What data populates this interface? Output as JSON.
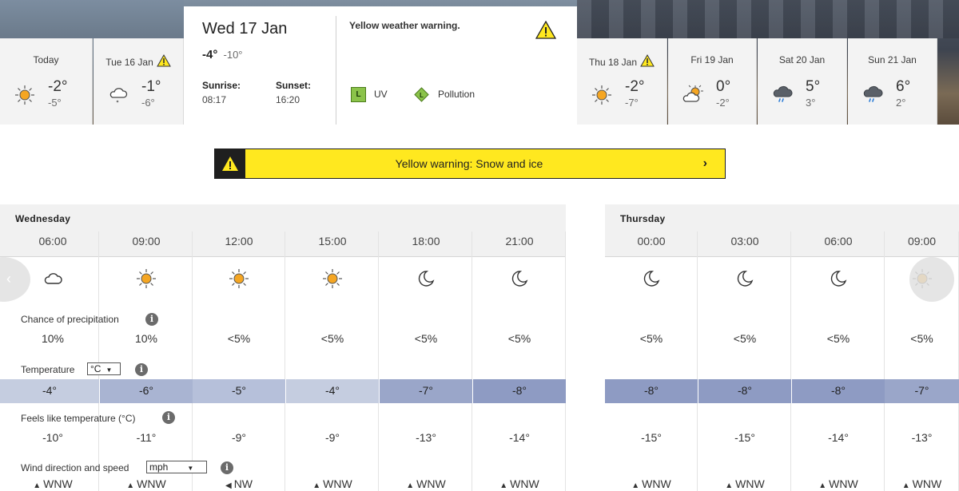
{
  "top": {
    "days": [
      {
        "label": "Today",
        "warn": false,
        "icon": "sun-icon",
        "hi": "-2°",
        "lo": "-5°"
      },
      {
        "label": "Tue 16 Jan",
        "warn": true,
        "icon": "cloud-snow-icon",
        "hi": "-1°",
        "lo": "-6°"
      },
      {
        "label": "Thu 18 Jan",
        "warn": true,
        "icon": "sun-icon",
        "hi": "-2°",
        "lo": "-7°"
      },
      {
        "label": "Fri 19 Jan",
        "warn": false,
        "icon": "sun-cloud-icon",
        "hi": "0°",
        "lo": "-2°"
      },
      {
        "label": "Sat 20 Jan",
        "warn": false,
        "icon": "rain-cloud-icon",
        "hi": "5°",
        "lo": "3°"
      },
      {
        "label": "Sun 21 Jan",
        "warn": false,
        "icon": "rain-cloud-icon",
        "hi": "6°",
        "lo": "2°"
      }
    ],
    "today": {
      "date": "Wed 17 Jan",
      "hi": "-4°",
      "lo": "-10°",
      "sunrise_label": "Sunrise:",
      "sunrise": "08:17",
      "sunset_label": "Sunset:",
      "sunset": "16:20",
      "warning_text": "Yellow weather warning.",
      "uv_badge": "L",
      "uv_label": "UV",
      "pollution_badge": "L",
      "pollution_label": "Pollution"
    }
  },
  "banner": {
    "text": "Yellow warning: Snow and ice",
    "chevron": "›"
  },
  "forecast": {
    "day1": "Wednesday",
    "day2": "Thursday",
    "precip_label": "Chance of precipitation",
    "temp_label": "Temperature",
    "temp_unit": "°C",
    "feels_label": "Feels like temperature (°C)",
    "wind_label": "Wind direction and speed",
    "wind_unit": "mph",
    "info_glyph": "i",
    "columns": [
      {
        "time": "06:00",
        "icon": "cloud-icon",
        "precip": "10%",
        "temp": "-4°",
        "feels": "-10°",
        "wind": "WNW",
        "wind_arrow": "▲",
        "band": "#c5cde0"
      },
      {
        "time": "09:00",
        "icon": "sun-icon",
        "precip": "10%",
        "temp": "-6°",
        "feels": "-11°",
        "wind": "WNW",
        "wind_arrow": "▲",
        "band": "#a9b4d2"
      },
      {
        "time": "12:00",
        "icon": "sun-icon",
        "precip": "<5%",
        "temp": "-5°",
        "feels": "-9°",
        "wind": "NW",
        "wind_arrow": "◀",
        "band": "#b6c0da"
      },
      {
        "time": "15:00",
        "icon": "sun-icon",
        "precip": "<5%",
        "temp": "-4°",
        "feels": "-9°",
        "wind": "WNW",
        "wind_arrow": "▲",
        "band": "#c5cde0"
      },
      {
        "time": "18:00",
        "icon": "moon-icon",
        "precip": "<5%",
        "temp": "-7°",
        "feels": "-13°",
        "wind": "WNW",
        "wind_arrow": "▲",
        "band": "#9aa6c9"
      },
      {
        "time": "21:00",
        "icon": "moon-icon",
        "precip": "<5%",
        "temp": "-8°",
        "feels": "-14°",
        "wind": "WNW",
        "wind_arrow": "▲",
        "band": "#8e9bc3"
      },
      {
        "time": "00:00",
        "icon": "moon-icon",
        "precip": "<5%",
        "temp": "-8°",
        "feels": "-15°",
        "wind": "WNW",
        "wind_arrow": "▲",
        "band": "#8e9bc3"
      },
      {
        "time": "03:00",
        "icon": "moon-icon",
        "precip": "<5%",
        "temp": "-8°",
        "feels": "-15°",
        "wind": "WNW",
        "wind_arrow": "▲",
        "band": "#8e9bc3"
      },
      {
        "time": "06:00",
        "icon": "moon-icon",
        "precip": "<5%",
        "temp": "-8°",
        "feels": "-14°",
        "wind": "WNW",
        "wind_arrow": "▲",
        "band": "#8e9bc3"
      },
      {
        "time": "09:00",
        "icon": "sun-icon",
        "precip": "<5%",
        "temp": "-7°",
        "feels": "-13°",
        "wind": "WNW",
        "wind_arrow": "▲",
        "band": "#9aa6c9"
      }
    ]
  },
  "colors": {
    "warning_yellow": "#ffe81f",
    "sun_orange": "#f5a623",
    "uv_green": "#8bc34a"
  }
}
